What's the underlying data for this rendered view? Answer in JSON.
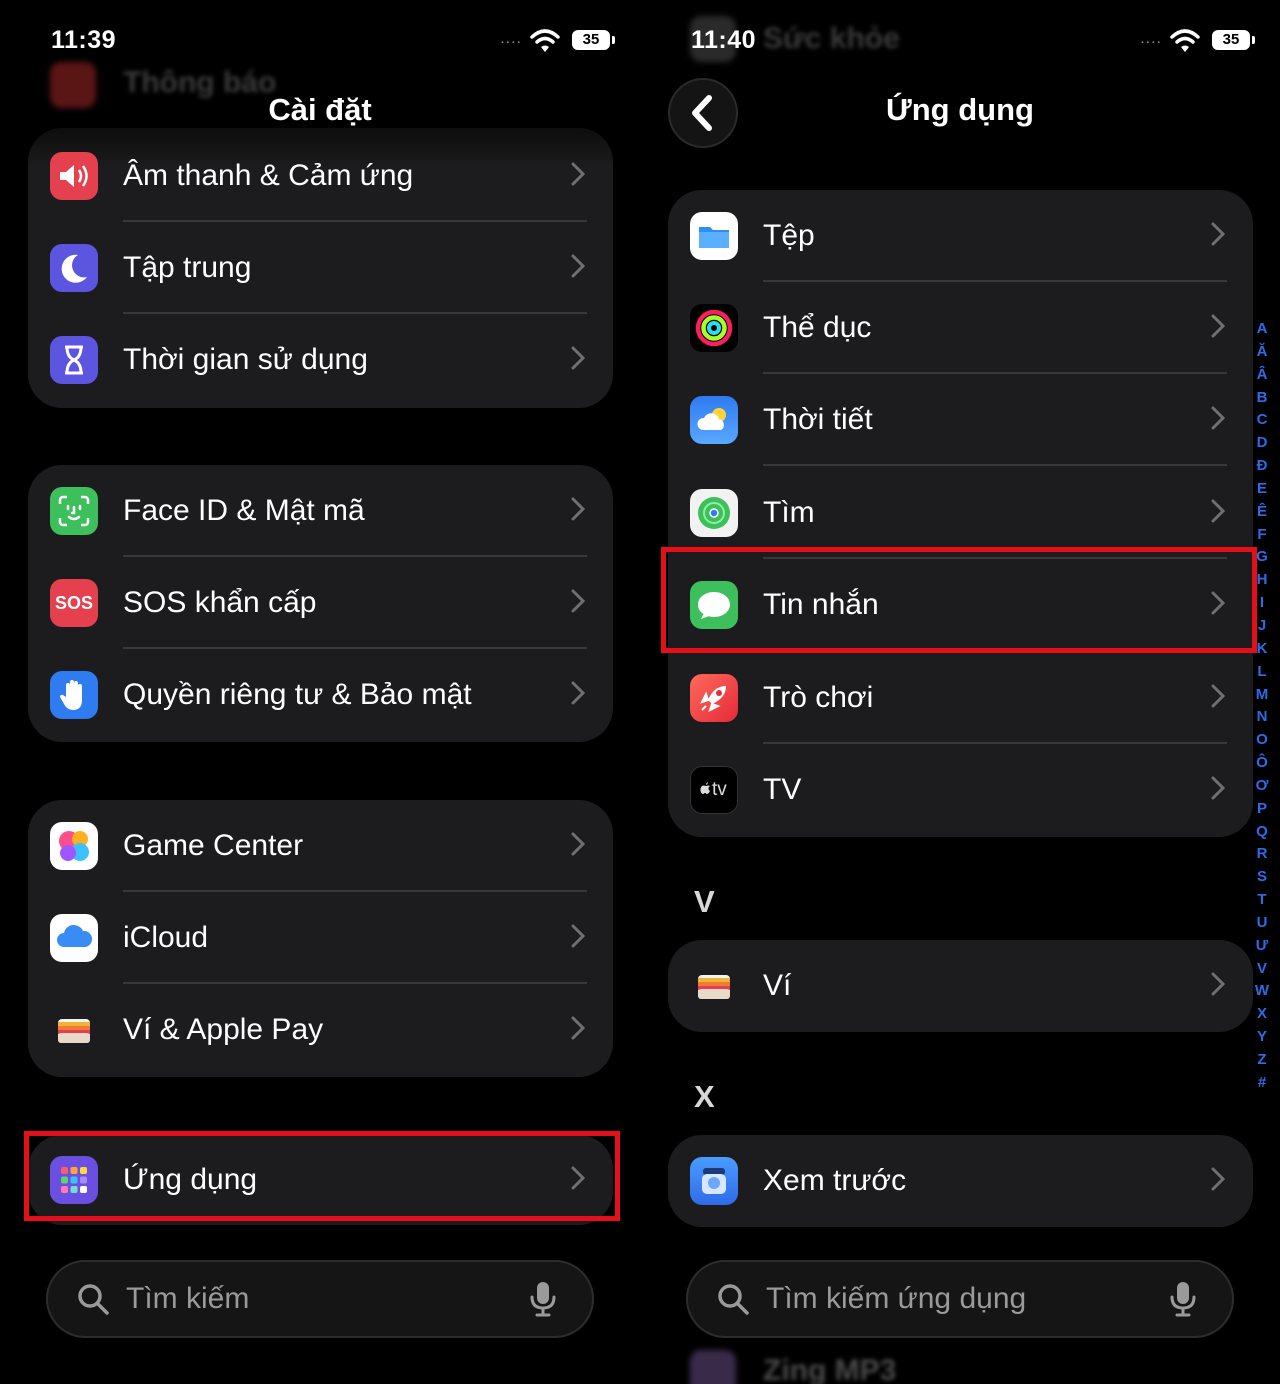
{
  "left_screen": {
    "status": {
      "time": "11:39",
      "battery": "35",
      "signal_dots": "...."
    },
    "ghost_header": "Thông báo",
    "nav_title": "Cài đặt",
    "group1": [
      {
        "label": "Âm thanh & Cảm ứng",
        "icon": "speaker-icon",
        "color": "#e5404e"
      },
      {
        "label": "Tập trung",
        "icon": "moon-icon",
        "color": "#5b55e0"
      },
      {
        "label": "Thời gian sử dụng",
        "icon": "hourglass-icon",
        "color": "#5b55e0"
      }
    ],
    "group2": [
      {
        "label": "Face ID & Mật mã",
        "icon": "face-id-icon",
        "color": "#3dbf5c"
      },
      {
        "label": "SOS khẩn cấp",
        "icon": "sos-icon",
        "color": "#e5404e",
        "icon_text": "SOS"
      },
      {
        "label": "Quyền riêng tư & Bảo mật",
        "icon": "hand-icon",
        "color": "#2f7bf0"
      }
    ],
    "group3": [
      {
        "label": "Game Center",
        "icon": "game-center-icon",
        "color": "#ffffff"
      },
      {
        "label": "iCloud",
        "icon": "icloud-icon",
        "color": "#ffffff"
      },
      {
        "label": "Ví & Apple Pay",
        "icon": "wallet-icon",
        "color": "#1c1c1e"
      }
    ],
    "group4": [
      {
        "label": "Ứng dụng",
        "icon": "apps-grid-icon",
        "color": "#6a4fe0"
      }
    ],
    "search_placeholder": "Tìm kiếm"
  },
  "right_screen": {
    "status": {
      "time": "11:40",
      "battery": "35",
      "signal_dots": "...."
    },
    "ghost_header": "Sức khỏe",
    "nav_title": "Ứng dụng",
    "group1": [
      {
        "label": "Tệp",
        "icon": "files-icon",
        "color": "#ffffff"
      },
      {
        "label": "Thể dục",
        "icon": "fitness-rings-icon",
        "color": "#000000"
      },
      {
        "label": "Thời tiết",
        "icon": "weather-icon",
        "color": "#2f7bf0"
      },
      {
        "label": "Tìm",
        "icon": "find-my-icon",
        "color": "#ffffff"
      },
      {
        "label": "Tin nhắn",
        "icon": "messages-icon",
        "color": "#3dbf5c"
      },
      {
        "label": "Trò chơi",
        "icon": "games-rocket-icon",
        "color": "#f04040"
      },
      {
        "label": "TV",
        "icon": "apple-tv-icon",
        "color": "#000000",
        "icon_text": "tv"
      }
    ],
    "section_v": "V",
    "group_v": [
      {
        "label": "Ví",
        "icon": "wallet-icon",
        "color": "#1c1c1e"
      }
    ],
    "section_x": "X",
    "group_x": [
      {
        "label": "Xem trước",
        "icon": "preview-icon",
        "color": "#2f7bf0"
      }
    ],
    "search_placeholder": "Tìm kiếm ứng dụng",
    "peek_row": "Zing MP3",
    "index_letters": [
      "A",
      "Ă",
      "Â",
      "B",
      "C",
      "D",
      "Đ",
      "E",
      "Ê",
      "F",
      "G",
      "H",
      "I",
      "J",
      "K",
      "L",
      "M",
      "N",
      "O",
      "Ô",
      "Ơ",
      "P",
      "Q",
      "R",
      "S",
      "T",
      "U",
      "Ư",
      "V",
      "W",
      "X",
      "Y",
      "Z",
      "#"
    ]
  },
  "colors": {
    "highlight": "#e3101a",
    "group_bg": "#1c1c1e",
    "index_blue": "#2f6be9"
  }
}
